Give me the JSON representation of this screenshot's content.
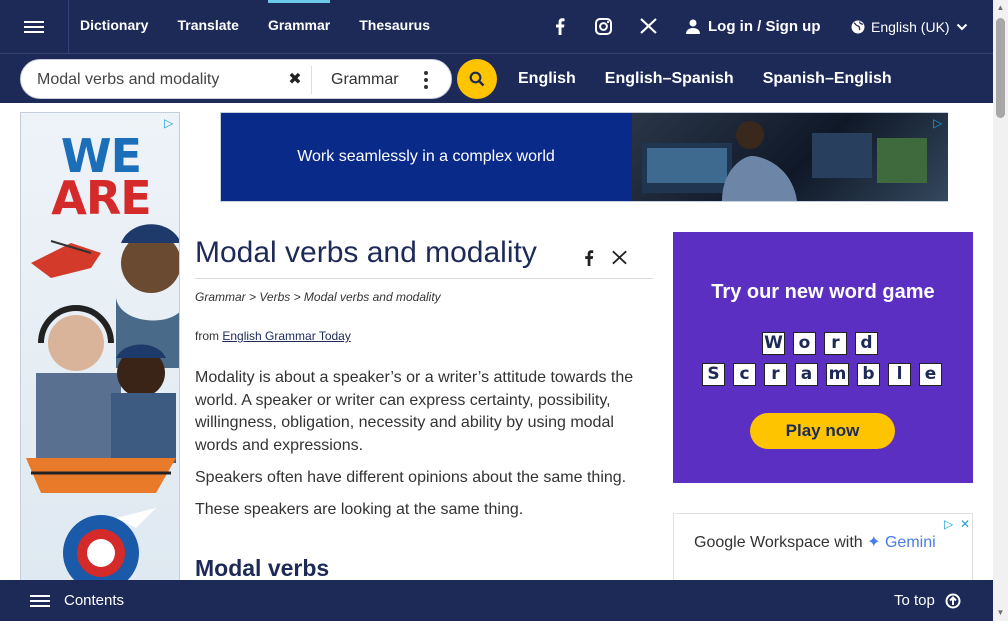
{
  "nav": {
    "links": [
      "Dictionary",
      "Translate",
      "Grammar",
      "Thesaurus"
    ],
    "active": "Grammar",
    "social_icons": [
      "facebook-icon",
      "instagram-icon",
      "x-icon"
    ],
    "login_label": "Log in / Sign up",
    "language_label": "English (UK)"
  },
  "search": {
    "value": "Modal verbs and modality",
    "dictionary": "Grammar",
    "lang_tabs": [
      "English",
      "English–Spanish",
      "Spanish–English"
    ]
  },
  "ads": {
    "left_headline_1": "WE",
    "left_headline_2": "ARE",
    "banner_text": "Work seamlessly in a complex world",
    "game_title": "Try our new word game",
    "game_row1": [
      "W",
      "o",
      "r",
      "d"
    ],
    "game_row2": [
      "S",
      "c",
      "r",
      "a",
      "m",
      "b",
      "l",
      "e"
    ],
    "game_button": "Play now",
    "gw_text": "Google Workspace with",
    "gw_brand": "✦ Gemini"
  },
  "article": {
    "title": "Modal verbs and modality",
    "breadcrumb": "Grammar > Verbs > Modal verbs and modality",
    "from_prefix": "from",
    "from_link": "English Grammar Today",
    "para1": "Modality is about a speaker’s or a writer’s attitude towards the world. A speaker or writer can express certainty, possibility, willingness, obligation, necessity and ability by using modal words and expressions.",
    "para2": "Speakers often have different opinions about the same thing.",
    "para3": "These speakers are looking at the same thing.",
    "subheading": "Modal verbs"
  },
  "footer": {
    "contents_label": "Contents",
    "to_top_label": "To top"
  },
  "colors": {
    "navy": "#1d2a57",
    "yellow": "#fec400",
    "purple": "#5b2fc1",
    "accent": "#6cc9e8"
  }
}
